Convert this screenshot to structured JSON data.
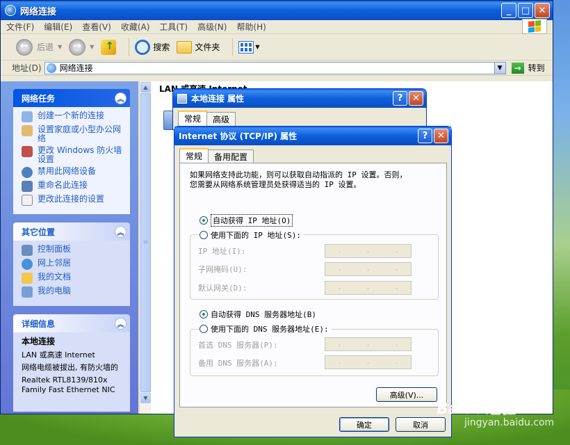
{
  "window": {
    "title": "网络连接",
    "minimize_label": "_",
    "maximize_label": "□",
    "close_label": "✕"
  },
  "menu": [
    "文件(F)",
    "编辑(E)",
    "查看(V)",
    "收藏(A)",
    "工具(T)",
    "高级(N)",
    "帮助(H)"
  ],
  "toolbar": {
    "back_label": "后退",
    "search_label": "搜索",
    "folders_label": "文件夹"
  },
  "address": {
    "label": "地址(D)",
    "value": "网络连接",
    "go_label": "转到"
  },
  "network_tasks": {
    "title": "网络任务",
    "items": [
      {
        "label": "创建一个新的连接",
        "icon": "new-connection-icon"
      },
      {
        "label": "设置家庭或小型办公网络",
        "icon": "home-network-icon"
      },
      {
        "label": "更改 Windows 防火墙设置",
        "icon": "firewall-icon"
      },
      {
        "label": "禁用此网络设备",
        "icon": "disable-device-icon"
      },
      {
        "label": "重命名此连接",
        "icon": "rename-icon"
      },
      {
        "label": "更改此连接的设置",
        "icon": "settings-icon"
      }
    ]
  },
  "other_places": {
    "title": "其它位置",
    "items": [
      {
        "label": "控制面板",
        "icon": "control-panel-icon"
      },
      {
        "label": "网上邻居",
        "icon": "network-places-icon"
      },
      {
        "label": "我的文档",
        "icon": "my-documents-icon"
      },
      {
        "label": "我的电脑",
        "icon": "my-computer-icon"
      }
    ]
  },
  "details": {
    "title": "详细信息",
    "name": "本地连接",
    "type": "LAN 或高速 Internet",
    "status": "网络电缆被拔出, 有防火墙的",
    "adapter": "Realtek RTL8139/810x Family Fast Ethernet NIC"
  },
  "content": {
    "group_header": "LAN 或高速 Internet"
  },
  "local_dialog": {
    "title": "本地连接 属性",
    "help": "?",
    "close": "✕",
    "tabs": [
      "常规",
      "高级"
    ]
  },
  "tcpip_dialog": {
    "title": "Internet 协议 (TCP/IP) 属性",
    "help": "?",
    "close": "✕",
    "tabs": [
      "常规",
      "备用配置"
    ],
    "info_line1": "如果网络支持此功能，则可以获取自动指派的 IP 设置。否则，",
    "info_line2": "您需要从网络系统管理员处获得适当的 IP 设置。",
    "auto_ip": "自动获得 IP 地址(O)",
    "manual_ip": "使用下面的 IP 地址(S):",
    "ip_label": "IP 地址(I):",
    "mask_label": "子网掩码(U):",
    "gateway_label": "默认网关(D):",
    "auto_dns": "自动获得 DNS 服务器地址(B)",
    "manual_dns": "使用下面的 DNS 服务器地址(E):",
    "pref_dns_label": "首选 DNS 服务器(P):",
    "alt_dns_label": "备用 DNS 服务器(A):",
    "advanced_label": "高级(V)...",
    "ok_label": "确定",
    "cancel_label": "取消",
    "ip_dots": "."
  },
  "watermark": {
    "brand": "Baidu经验",
    "url": "jingyan.baidu.com"
  }
}
